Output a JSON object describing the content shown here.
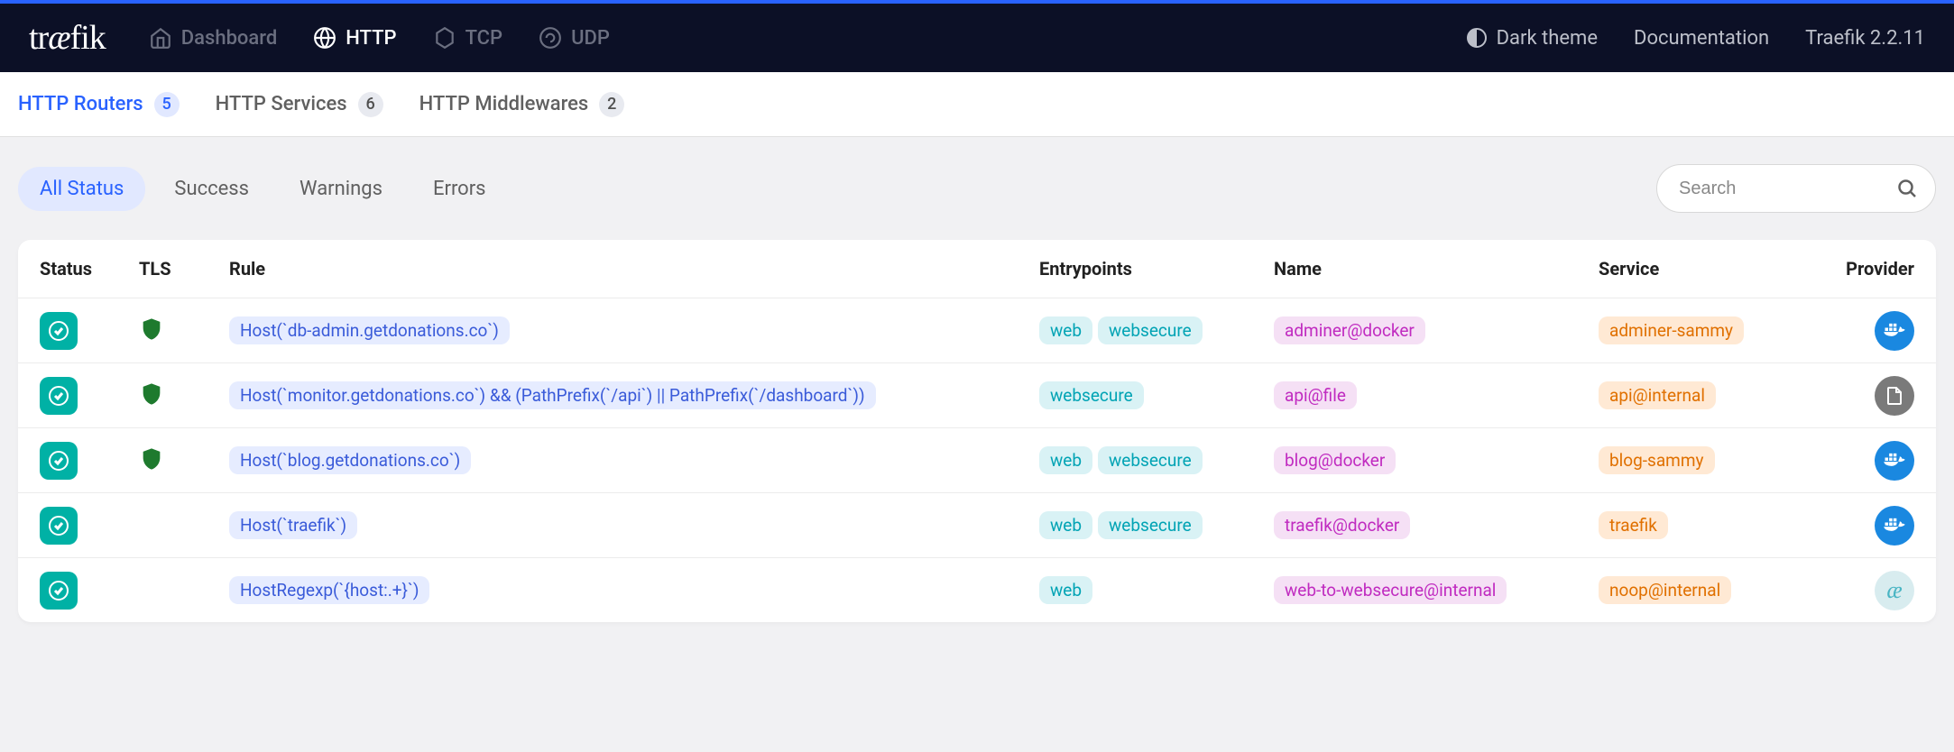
{
  "header": {
    "logo": "træfik",
    "nav": [
      {
        "label": "Dashboard",
        "active": false
      },
      {
        "label": "HTTP",
        "active": true
      },
      {
        "label": "TCP",
        "active": false
      },
      {
        "label": "UDP",
        "active": false
      }
    ],
    "right": {
      "theme": "Dark theme",
      "documentation": "Documentation",
      "version": "Traefik 2.2.11"
    }
  },
  "subnav": [
    {
      "label": "HTTP Routers",
      "count": "5",
      "active": true
    },
    {
      "label": "HTTP Services",
      "count": "6",
      "active": false
    },
    {
      "label": "HTTP Middlewares",
      "count": "2",
      "active": false
    }
  ],
  "filters": [
    {
      "label": "All Status",
      "active": true
    },
    {
      "label": "Success",
      "active": false
    },
    {
      "label": "Warnings",
      "active": false
    },
    {
      "label": "Errors",
      "active": false
    }
  ],
  "search": {
    "placeholder": "Search"
  },
  "table": {
    "headers": {
      "status": "Status",
      "tls": "TLS",
      "rule": "Rule",
      "entrypoints": "Entrypoints",
      "name": "Name",
      "service": "Service",
      "provider": "Provider"
    },
    "rows": [
      {
        "tls": true,
        "rule": "Host(`db-admin.getdonations.co`)",
        "entrypoints": [
          "web",
          "websecure"
        ],
        "name": "adminer@docker",
        "service": "adminer-sammy",
        "provider": "docker"
      },
      {
        "tls": true,
        "rule": "Host(`monitor.getdonations.co`) && (PathPrefix(`/api`) || PathPrefix(`/dashboard`))",
        "entrypoints": [
          "websecure"
        ],
        "name": "api@file",
        "service": "api@internal",
        "provider": "file"
      },
      {
        "tls": true,
        "rule": "Host(`blog.getdonations.co`)",
        "entrypoints": [
          "web",
          "websecure"
        ],
        "name": "blog@docker",
        "service": "blog-sammy",
        "provider": "docker"
      },
      {
        "tls": false,
        "rule": "Host(`traefik`)",
        "entrypoints": [
          "web",
          "websecure"
        ],
        "name": "traefik@docker",
        "service": "traefik",
        "provider": "docker"
      },
      {
        "tls": false,
        "rule": "HostRegexp(`{host:.+}`)",
        "entrypoints": [
          "web"
        ],
        "name": "web-to-websecure@internal",
        "service": "noop@internal",
        "provider": "internal"
      }
    ]
  }
}
